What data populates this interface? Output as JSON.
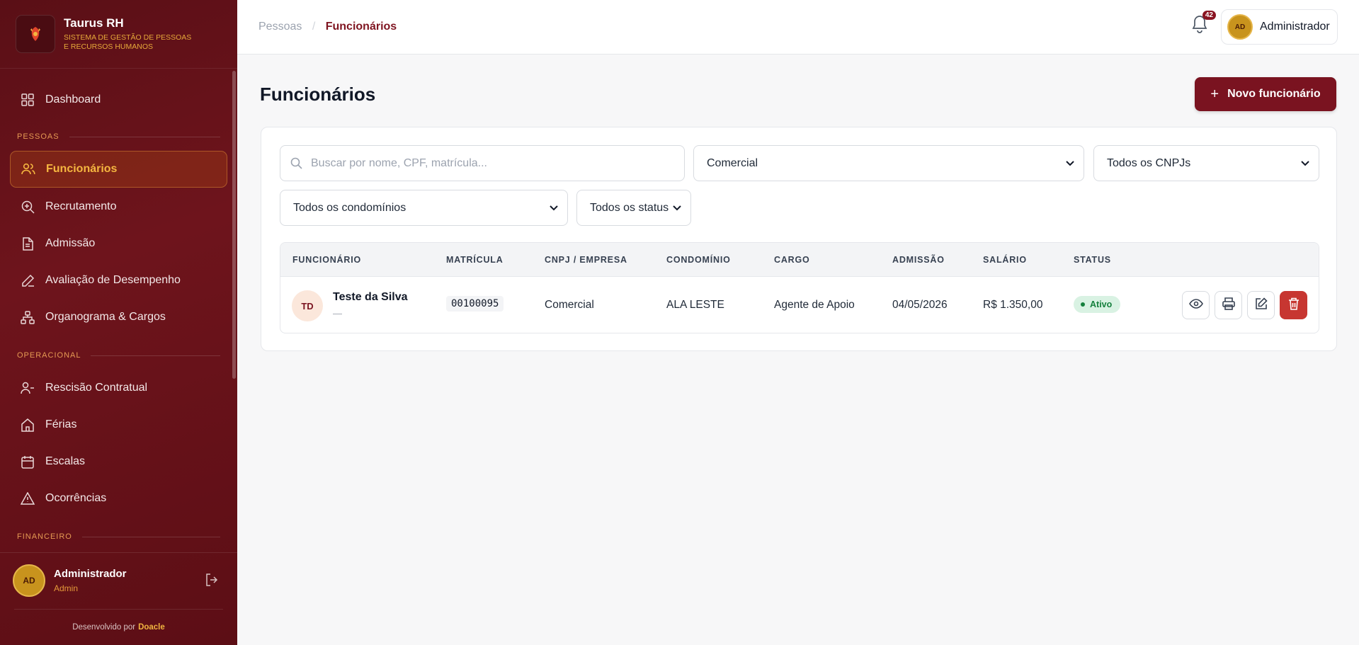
{
  "brand": {
    "title": "Taurus RH",
    "subtitle": "Sistema de Gestão de Pessoas e Recursos Humanos"
  },
  "sidebar": {
    "items_top": [
      {
        "label": "Dashboard",
        "icon": "grid-icon"
      }
    ],
    "section_pessoas": "PESSOAS",
    "items_pessoas": [
      {
        "label": "Funcionários",
        "icon": "users-icon",
        "active": true
      },
      {
        "label": "Recrutamento",
        "icon": "search-plus-icon"
      },
      {
        "label": "Admissão",
        "icon": "document-icon"
      },
      {
        "label": "Avaliação de Desempenho",
        "icon": "pen-icon"
      },
      {
        "label": "Organograma & Cargos",
        "icon": "org-chart-icon"
      }
    ],
    "section_operacional": "OPERACIONAL",
    "items_operacional": [
      {
        "label": "Rescisão Contratual",
        "icon": "user-minus-icon"
      },
      {
        "label": "Férias",
        "icon": "home-icon"
      },
      {
        "label": "Escalas",
        "icon": "calendar-icon"
      },
      {
        "label": "Ocorrências",
        "icon": "warning-icon"
      }
    ],
    "section_financeiro": "FINANCEIRO",
    "user": {
      "initials": "AD",
      "name": "Administrador",
      "role": "Admin"
    },
    "footer_prefix": "Desenvolvido por",
    "footer_brand": "Doacle"
  },
  "topbar": {
    "breadcrumb": [
      "Pessoas",
      "Funcionários"
    ],
    "notifications": "42",
    "user_initials": "AD",
    "user_name": "Administrador"
  },
  "main": {
    "title": "Funcionários",
    "new_button": "Novo funcionário",
    "filters": {
      "search_placeholder": "Buscar por nome, CPF, matrícula...",
      "department": "Comercial",
      "cnpj": "Todos os CNPJs",
      "condominio": "Todos os condomínios",
      "status": "Todos os status"
    },
    "table": {
      "headers": [
        "FUNCIONÁRIO",
        "MATRÍCULA",
        "CNPJ / EMPRESA",
        "CONDOMÍNIO",
        "CARGO",
        "ADMISSÃO",
        "SALÁRIO",
        "STATUS"
      ],
      "rows": [
        {
          "initials": "TD",
          "name": "Teste da Silva",
          "sub": "—",
          "matricula": "00100095",
          "empresa": "Comercial",
          "condominio": "ALA LESTE",
          "cargo": "Agente de Apoio",
          "admissao": "04/05/2026",
          "salario": "R$ 1.350,00",
          "status": "Ativo"
        }
      ]
    }
  },
  "colors": {
    "brand": "#7a1320",
    "accent": "#f5b640",
    "success": "#15803d",
    "danger": "#c73631"
  }
}
